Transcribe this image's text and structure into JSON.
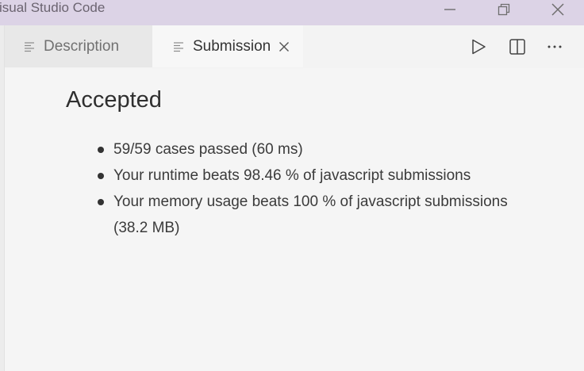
{
  "window": {
    "title": "Visual Studio Code",
    "controls": [
      "minimize-icon",
      "restore-icon",
      "close-icon"
    ]
  },
  "tabs": [
    {
      "label": "Description",
      "icon": "document-lines-icon",
      "active": false
    },
    {
      "label": "Submission",
      "icon": "document-lines-icon",
      "active": true,
      "closable": true
    }
  ],
  "actions": [
    "run-icon",
    "split-editor-icon",
    "more-actions-icon"
  ],
  "result": {
    "heading": "Accepted",
    "items": [
      "59/59 cases passed (60 ms)",
      "Your runtime beats 98.46 % of javascript submissions",
      "Your memory usage beats 100 % of javascript submissions (38.2 MB)"
    ]
  }
}
